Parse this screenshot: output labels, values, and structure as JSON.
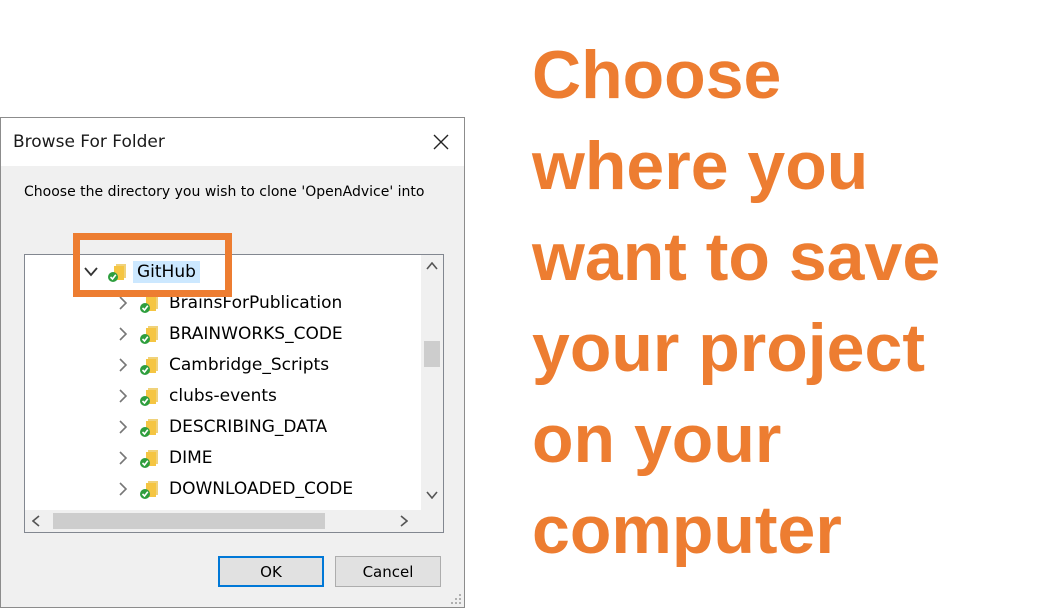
{
  "dialog": {
    "title": "Browse For Folder",
    "instruction": "Choose the directory you wish to clone 'OpenAdvice' into",
    "ok_label": "OK",
    "cancel_label": "Cancel"
  },
  "tree": {
    "root": {
      "label": "GitHub",
      "expanded": true,
      "selected": true
    },
    "items": [
      {
        "label": "BrainsForPublication"
      },
      {
        "label": "BRAINWORKS_CODE"
      },
      {
        "label": "Cambridge_Scripts"
      },
      {
        "label": "clubs-events"
      },
      {
        "label": "DESCRIBING_DATA"
      },
      {
        "label": "DIME"
      },
      {
        "label": "DOWNLOADED_CODE"
      }
    ]
  },
  "caption": {
    "lines": [
      "Choose",
      "where you",
      "want to save",
      "your project",
      "on your",
      "computer"
    ]
  },
  "colors": {
    "accent": "#ed7d31",
    "folder": "#f5c542",
    "sync_badge": "#2e9e3e",
    "selection": "#cce8ff"
  },
  "icons": {
    "close": "close-icon",
    "folder": "folder-icon",
    "expand": "chevron-right-icon",
    "collapse": "chevron-down-icon"
  }
}
